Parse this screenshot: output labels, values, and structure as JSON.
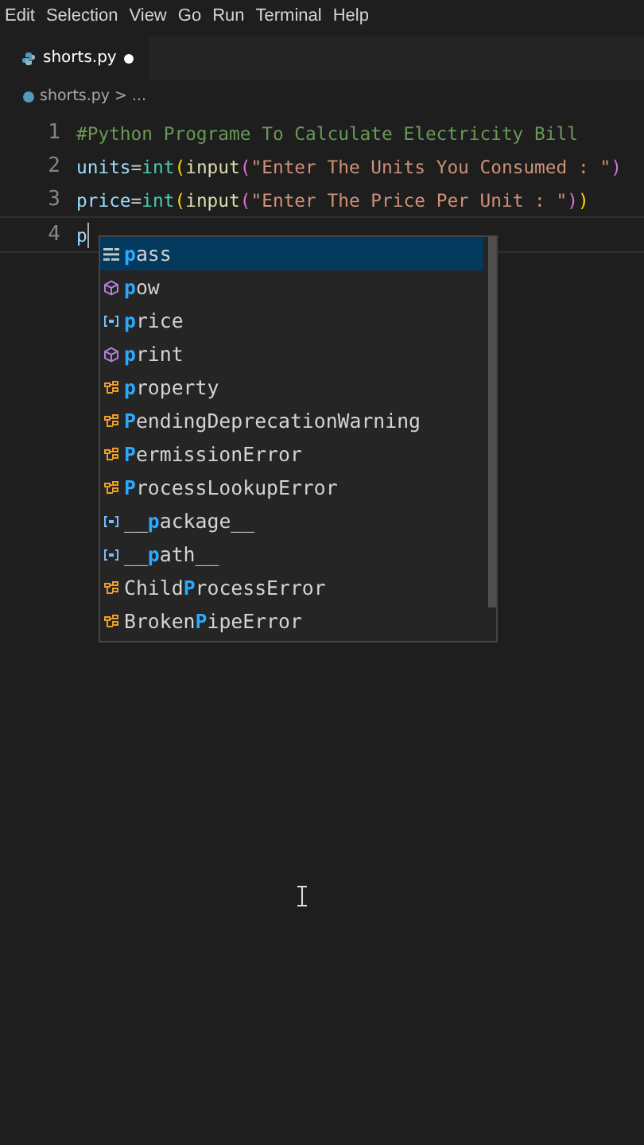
{
  "menu": [
    "Edit",
    "Selection",
    "View",
    "Go",
    "Run",
    "Terminal",
    "Help"
  ],
  "tab": {
    "label": "shorts.py",
    "modified": true,
    "selected": true
  },
  "breadcrumb": {
    "file": "shorts.py",
    "sep": ">",
    "rest": "..."
  },
  "lines": [
    {
      "number": "1",
      "tokens": [
        {
          "kind": "comment",
          "text": "#Python Programe To Calculate Electricity Bill"
        }
      ]
    },
    {
      "number": "2",
      "tokens": [
        {
          "kind": "var",
          "text": "units"
        },
        {
          "kind": "op",
          "text": "="
        },
        {
          "kind": "builtin",
          "text": "int"
        },
        {
          "kind": "paren",
          "text": "("
        },
        {
          "kind": "func",
          "text": "input"
        },
        {
          "kind": "paren2",
          "text": "("
        },
        {
          "kind": "string",
          "text": "\"Enter The Units You Consumed : \""
        },
        {
          "kind": "paren2",
          "text": ")"
        }
      ]
    },
    {
      "number": "3",
      "tokens": [
        {
          "kind": "var",
          "text": "price"
        },
        {
          "kind": "op",
          "text": "="
        },
        {
          "kind": "builtin",
          "text": "int"
        },
        {
          "kind": "paren",
          "text": "("
        },
        {
          "kind": "func",
          "text": "input"
        },
        {
          "kind": "paren2",
          "text": "("
        },
        {
          "kind": "string",
          "text": "\"Enter The Price Per Unit : \""
        },
        {
          "kind": "paren2",
          "text": ")"
        },
        {
          "kind": "paren",
          "text": ")"
        }
      ]
    },
    {
      "number": "4",
      "tokens": [
        {
          "kind": "var",
          "text": "p"
        }
      ],
      "cursor": true
    }
  ],
  "suggestions": [
    {
      "kind": "keyword",
      "match": "p",
      "after": "ass",
      "selected": true
    },
    {
      "kind": "function",
      "match": "p",
      "after": "ow",
      "selected": false
    },
    {
      "kind": "variable",
      "match": "p",
      "after": "rice",
      "selected": false
    },
    {
      "kind": "function",
      "match": "p",
      "after": "rint",
      "selected": false
    },
    {
      "kind": "class",
      "match": "p",
      "after": "roperty",
      "selected": false
    },
    {
      "kind": "class",
      "match": "P",
      "after": "endingDeprecationWarning",
      "selected": false
    },
    {
      "kind": "class",
      "match": "P",
      "after": "ermissionError",
      "selected": false
    },
    {
      "kind": "class",
      "match": "P",
      "after": "rocessLookupError",
      "selected": false
    },
    {
      "kind": "variable",
      "before": "__",
      "match": "p",
      "after": "ackage__",
      "selected": false
    },
    {
      "kind": "variable",
      "before": "__",
      "match": "p",
      "after": "ath__",
      "selected": false
    },
    {
      "kind": "class",
      "before": "Child",
      "match": "P",
      "after": "rocessError",
      "selected": false
    },
    {
      "kind": "class",
      "before": "Broken",
      "match": "P",
      "after": "ipeError",
      "selected": false
    }
  ]
}
